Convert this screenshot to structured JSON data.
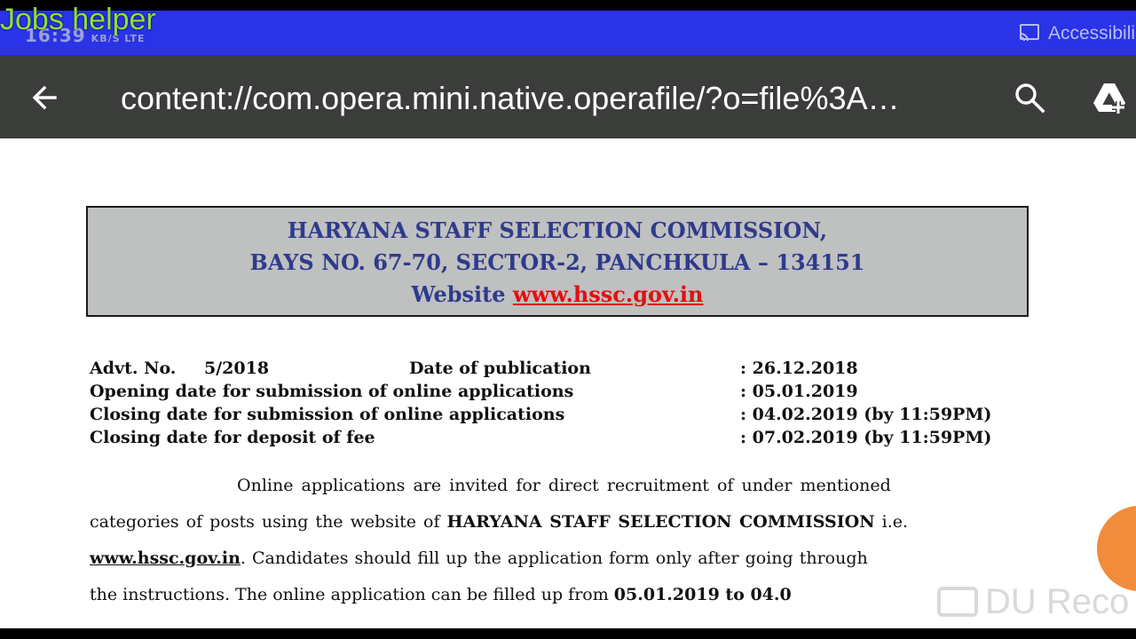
{
  "watermark": {
    "top_label": "Jobs helper",
    "bottom_label": "DU Reco"
  },
  "status_bar": {
    "time": "16:39",
    "network": "KB/S LTE",
    "accessibility": "Accessibili"
  },
  "toolbar": {
    "url": "content://com.opera.mini.native.operafile/?o=file%3A…"
  },
  "header": {
    "line1": "HARYANA STAFF SELECTION COMMISSION,",
    "line2": "BAYS NO. 67-70, SECTOR-2, PANCHKULA – 134151",
    "website_label": "Website ",
    "website_link": "www.hssc.gov.in"
  },
  "info": {
    "advt_label": "Advt. No.",
    "advt_no": "5/2018",
    "pub_label": "Date of publication",
    "pub_value": ": 26.12.2018",
    "open_label": "Opening date for submission of online applications",
    "open_value": ": 05.01.2019",
    "close_label": "Closing date for submission of online applications",
    "close_value": ": 04.02.2019 (by 11:59PM)",
    "fee_label": "Closing date for deposit of fee",
    "fee_value": ": 07.02.2019 (by 11:59PM)"
  },
  "body": {
    "l1": "Online applications are invited for direct recruitment of under mentioned",
    "l2a": "categories of posts using the website of ",
    "l2b": "HARYANA STAFF SELECTION COMMISSION",
    "l2c": " i.e.",
    "l3a": "www.hssc.gov.in",
    "l3b": ". Candidates should fill up the application form only after going through",
    "l4a": "the instructions.  The online application can be filled up from ",
    "l4b": "05.01.2019 to 04.0"
  },
  "icons": {
    "back": "arrow-left-icon",
    "search": "search-icon",
    "drive": "drive-icon",
    "cast": "cast-icon"
  },
  "colors": {
    "status_bar": "#2a33e6",
    "app_bar": "#3a3d3a",
    "header_text": "#2e3b8c",
    "link_red": "#e01010",
    "fab": "#f08c3c"
  }
}
